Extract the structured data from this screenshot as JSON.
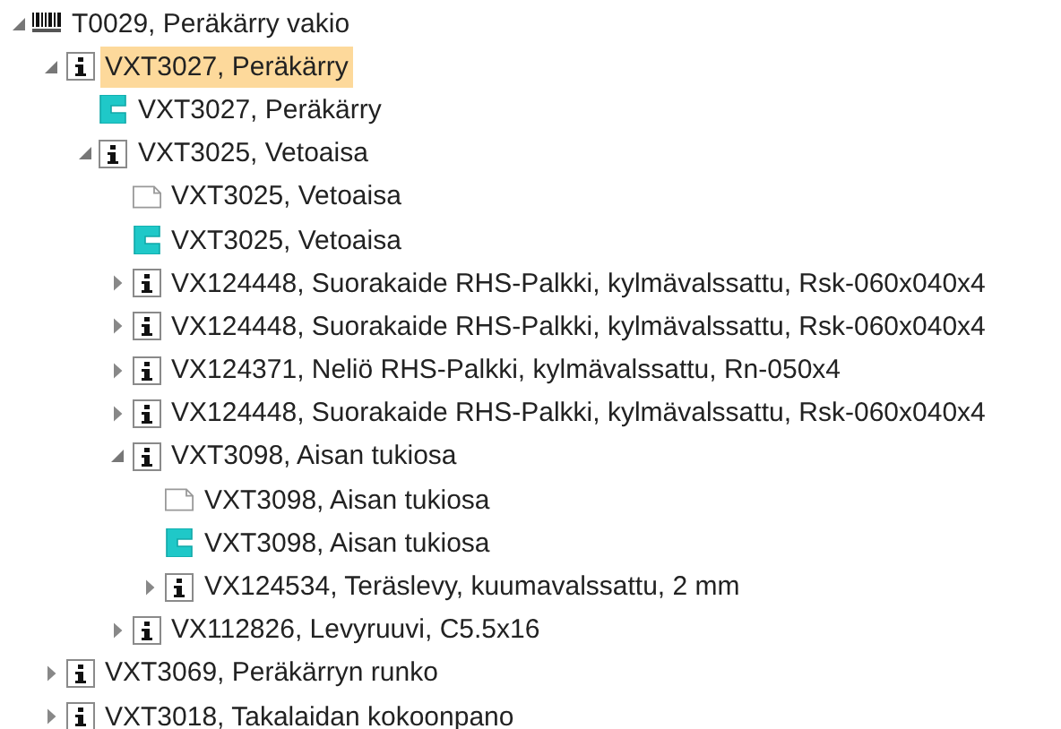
{
  "tree": [
    {
      "label": "T0029, Peräkärry vakio",
      "kind": "barcode",
      "expanded": true,
      "selected": false,
      "children": [
        {
          "label": "VXT3027, Peräkärry",
          "kind": "info",
          "expanded": true,
          "selected": true,
          "children": [
            {
              "label": "VXT3027, Peräkärry",
              "kind": "part",
              "selected": false
            },
            {
              "label": "VXT3025, Vetoaisa",
              "kind": "info",
              "expanded": true,
              "selected": false,
              "children": [
                {
                  "label": "VXT3025, Vetoaisa",
                  "kind": "document",
                  "selected": false
                },
                {
                  "label": "VXT3025, Vetoaisa",
                  "kind": "part",
                  "selected": false
                },
                {
                  "label": "VX124448, Suorakaide RHS-Palkki, kylmävalssattu, Rsk-060x040x4",
                  "kind": "info",
                  "expanded": false,
                  "selected": false
                },
                {
                  "label": "VX124448, Suorakaide RHS-Palkki, kylmävalssattu, Rsk-060x040x4",
                  "kind": "info",
                  "expanded": false,
                  "selected": false
                },
                {
                  "label": "VX124371, Neliö RHS-Palkki, kylmävalssattu, Rn-050x4",
                  "kind": "info",
                  "expanded": false,
                  "selected": false
                },
                {
                  "label": "VX124448, Suorakaide RHS-Palkki, kylmävalssattu, Rsk-060x040x4",
                  "kind": "info",
                  "expanded": false,
                  "selected": false
                },
                {
                  "label": "VXT3098, Aisan tukiosa",
                  "kind": "info",
                  "expanded": true,
                  "selected": false,
                  "children": [
                    {
                      "label": "VXT3098, Aisan tukiosa",
                      "kind": "document",
                      "selected": false
                    },
                    {
                      "label": "VXT3098, Aisan tukiosa",
                      "kind": "part",
                      "selected": false
                    },
                    {
                      "label": "VX124534, Teräslevy, kuumavalssattu, 2 mm",
                      "kind": "info",
                      "expanded": false,
                      "selected": false
                    }
                  ]
                },
                {
                  "label": "VX112826, Levyruuvi, C5.5x16",
                  "kind": "info",
                  "expanded": false,
                  "selected": false
                }
              ]
            }
          ]
        },
        {
          "label": "VXT3069, Peräkärryn runko",
          "kind": "info",
          "expanded": false,
          "selected": false
        },
        {
          "label": "VXT3018, Takalaidan kokoonpano",
          "kind": "info",
          "expanded": false,
          "selected": false
        }
      ]
    }
  ]
}
